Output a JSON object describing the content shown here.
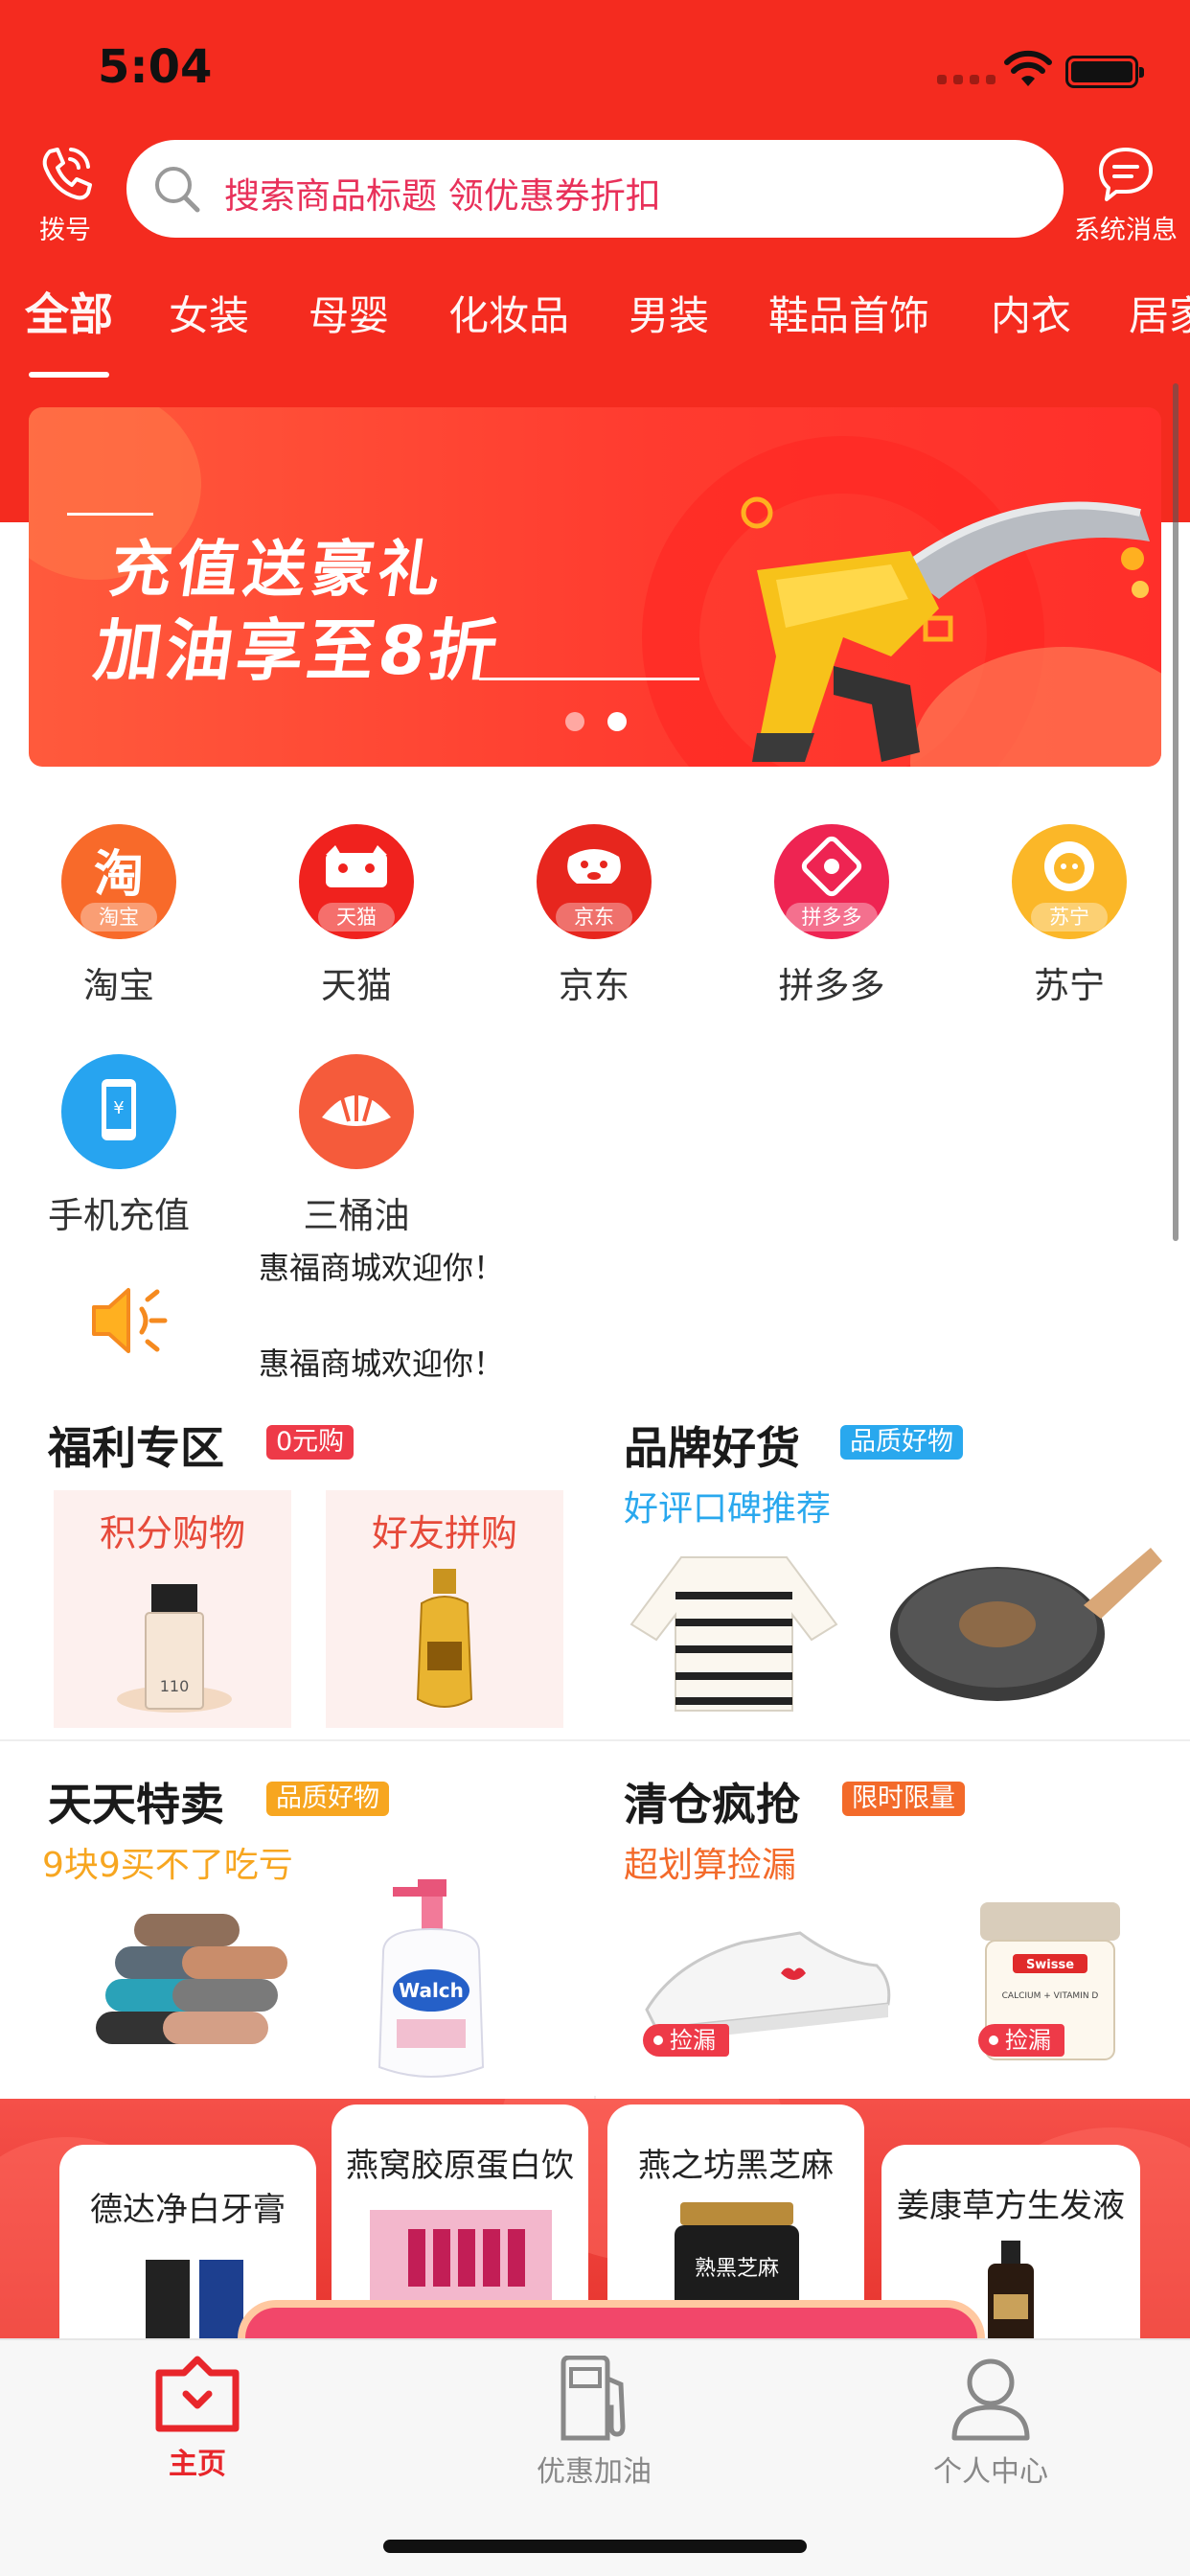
{
  "status": {
    "time": "5:04"
  },
  "header": {
    "dial_label": "拨号",
    "search_placeholder": "搜索商品标题 领优惠券折扣",
    "message_label": "系统消息"
  },
  "categories": [
    "全部",
    "女装",
    "母婴",
    "化妆品",
    "男装",
    "鞋品首饰",
    "内衣",
    "居家"
  ],
  "banner": {
    "line1": "充值送豪礼",
    "line2": "加油享至8折"
  },
  "platforms": [
    {
      "name": "淘宝",
      "badge": "淘宝",
      "glyph": "淘",
      "color": "#f86a2a"
    },
    {
      "name": "天猫",
      "badge": "天猫",
      "glyph": "",
      "color": "#f0221e"
    },
    {
      "name": "京东",
      "badge": "京东",
      "glyph": "",
      "color": "#e7261e"
    },
    {
      "name": "拼多多",
      "badge": "拼多多",
      "glyph": "",
      "color": "#ee2452"
    },
    {
      "name": "苏宁",
      "badge": "苏宁",
      "glyph": "",
      "color": "#fbb728"
    },
    {
      "name": "手机充值",
      "badge": "",
      "glyph": "",
      "color": "#27a4f0"
    },
    {
      "name": "三桶油",
      "badge": "",
      "glyph": "",
      "color": "#f55b3b"
    }
  ],
  "notice": {
    "text_prev": "惠福商城欢迎你！",
    "text_next": "惠福商城欢迎你！"
  },
  "promos": {
    "welfare": {
      "title": "福利专区",
      "tag": "0元购",
      "card1": "积分购物",
      "card2": "好友拼购"
    },
    "brand": {
      "title": "品牌好货",
      "tag": "品质好物",
      "subtitle": "好评口碑推荐"
    },
    "daily": {
      "title": "天天特卖",
      "tag": "品质好物",
      "subtitle": "9块9买不了吃亏"
    },
    "clearance": {
      "title": "清仓疯抢",
      "tag": "限时限量",
      "subtitle": "超划算捡漏",
      "leak1": "捡漏",
      "leak2": "捡漏"
    }
  },
  "product_labels": {
    "bottle": "110",
    "handwash": "Walch",
    "jar": "Swisse",
    "jar_sub": "CALCIUM + VITAMIN D",
    "sesame": "熟黑芝麻"
  },
  "recommend": [
    "德达净白牙膏",
    "燕窝胶原蛋白饮",
    "燕之坊黑芝麻",
    "姜康草方生发液"
  ],
  "tabbar": {
    "home": "主页",
    "fuel": "优惠加油",
    "profile": "个人中心",
    "active_color": "#e8262b",
    "inactive_color": "#888888"
  }
}
